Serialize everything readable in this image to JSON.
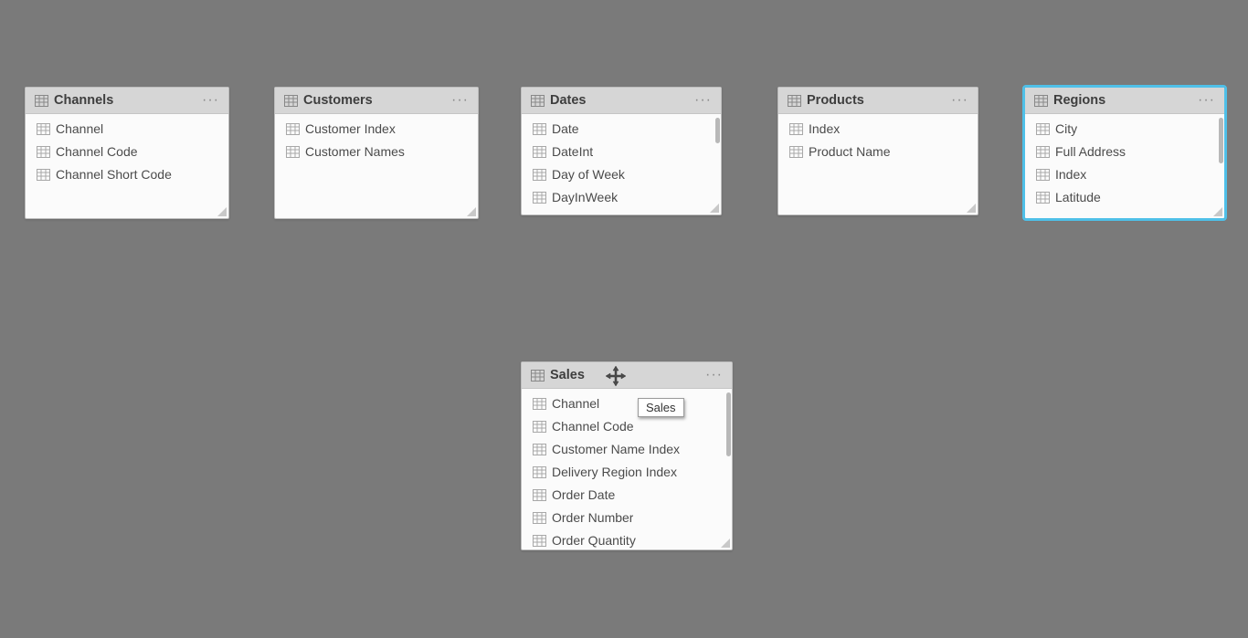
{
  "tables": {
    "channels": {
      "title": "Channels",
      "fields": [
        "Channel",
        "Channel Code",
        "Channel Short Code"
      ]
    },
    "customers": {
      "title": "Customers",
      "fields": [
        "Customer Index",
        "Customer Names"
      ]
    },
    "dates": {
      "title": "Dates",
      "fields": [
        "Date",
        "DateInt",
        "Day of Week",
        "DayInWeek"
      ]
    },
    "products": {
      "title": "Products",
      "fields": [
        "Index",
        "Product Name"
      ]
    },
    "regions": {
      "title": "Regions",
      "fields": [
        "City",
        "Full Address",
        "Index",
        "Latitude"
      ]
    },
    "sales": {
      "title": "Sales",
      "fields": [
        "Channel",
        "Channel Code",
        "Customer Name Index",
        "Delivery Region Index",
        "Order Date",
        "Order Number",
        "Order Quantity"
      ]
    }
  },
  "tooltip": {
    "sales": "Sales"
  },
  "menu_glyph": "···"
}
